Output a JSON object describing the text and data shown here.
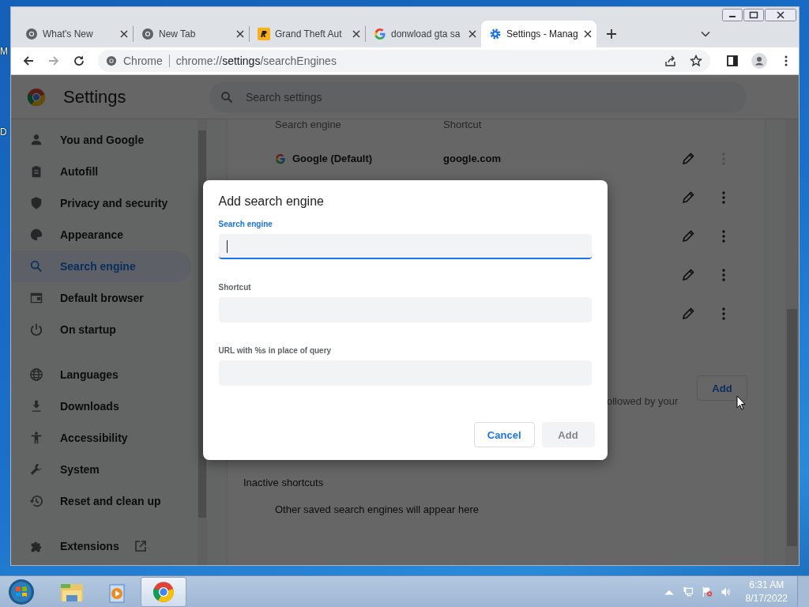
{
  "desktop_labels": [
    "M",
    "D"
  ],
  "tabs": [
    {
      "title": "What's New",
      "kind": "chrome",
      "selected": false
    },
    {
      "title": "New Tab",
      "kind": "chrome",
      "selected": false
    },
    {
      "title": "Grand Theft Aut",
      "kind": "game",
      "selected": false
    },
    {
      "title": "donwload gta sa",
      "kind": "google",
      "selected": false
    },
    {
      "title": "Settings - Manag",
      "kind": "gear",
      "selected": true
    }
  ],
  "toolbar": {
    "site_label": "Chrome",
    "url": {
      "scheme": "chrome://",
      "host": "settings",
      "path": "/searchEngines"
    }
  },
  "settings": {
    "title": "Settings",
    "search_placeholder": "Search settings"
  },
  "sidebar": {
    "groups": [
      [
        {
          "label": "You and Google",
          "kind": "person",
          "selected": false
        },
        {
          "label": "Autofill",
          "kind": "clipboard",
          "selected": false
        },
        {
          "label": "Privacy and security",
          "kind": "shield",
          "selected": false
        },
        {
          "label": "Appearance",
          "kind": "palette",
          "selected": false
        },
        {
          "label": "Search engine",
          "kind": "search",
          "selected": true
        },
        {
          "label": "Default browser",
          "kind": "browser",
          "selected": false
        },
        {
          "label": "On startup",
          "kind": "power",
          "selected": false
        }
      ],
      [
        {
          "label": "Languages",
          "kind": "globe",
          "selected": false
        },
        {
          "label": "Downloads",
          "kind": "download",
          "selected": false
        },
        {
          "label": "Accessibility",
          "kind": "accessibility",
          "selected": false
        },
        {
          "label": "System",
          "kind": "wrench",
          "selected": false
        },
        {
          "label": "Reset and clean up",
          "kind": "history",
          "selected": false
        }
      ],
      [
        {
          "label": "Extensions",
          "kind": "puzzle",
          "selected": false,
          "external_link": true
        }
      ]
    ]
  },
  "engines": {
    "columns": [
      "Search engine",
      "Shortcut"
    ],
    "rows": [
      {
        "name": "Google (Default)",
        "shortcut": "google.com",
        "kind": "google",
        "more_disabled": true
      },
      {
        "more_disabled": false
      },
      {
        "more_disabled": false
      },
      {
        "more_disabled": false
      },
      {
        "more_disabled": false
      }
    ],
    "add_button": "Add",
    "note_fragment": "ollowed by your"
  },
  "inactive": {
    "title": "Inactive shortcuts",
    "empty": "Other saved search engines will appear here"
  },
  "dialog": {
    "title": "Add search engine",
    "fields": [
      {
        "label": "Search engine",
        "focused": true
      },
      {
        "label": "Shortcut",
        "focused": false
      },
      {
        "label": "URL with %s in place of query",
        "focused": false
      }
    ],
    "buttons": [
      {
        "label": "Cancel",
        "disabled": false
      },
      {
        "label": "Add",
        "disabled": true
      }
    ]
  },
  "taskbar": {
    "apps": [
      {
        "kind": "explorer",
        "selected": false
      },
      {
        "kind": "media",
        "selected": false
      },
      {
        "kind": "chrome",
        "selected": true
      }
    ],
    "time": "6:31 AM",
    "date": "8/17/2022"
  }
}
